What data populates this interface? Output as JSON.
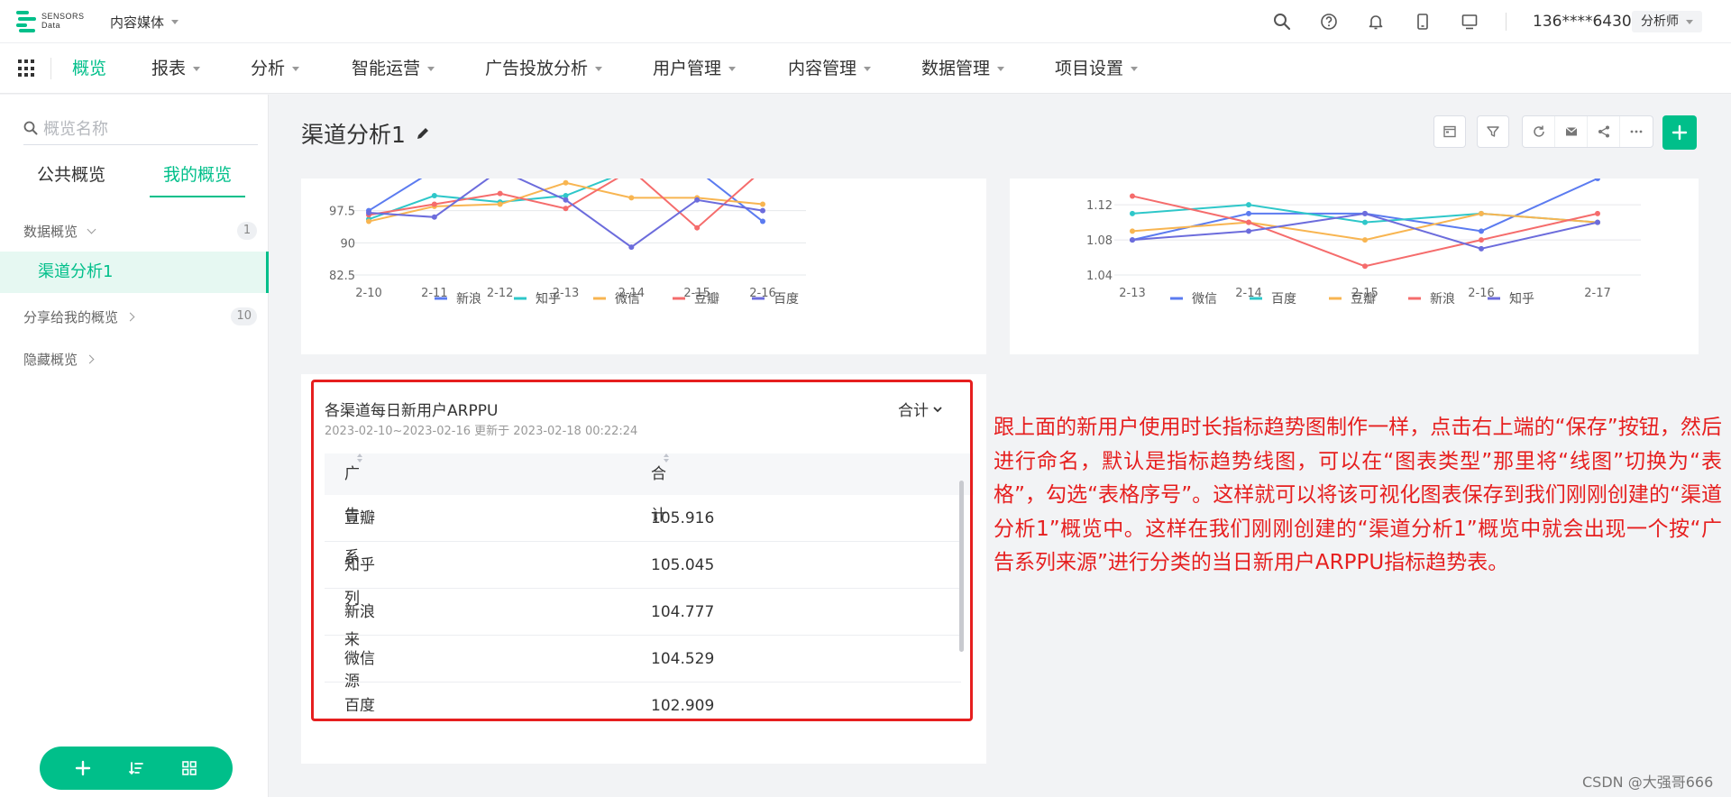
{
  "brand": {
    "logo_line1": "SENSORS",
    "logo_line2": "Data",
    "accent": "#00bf8a"
  },
  "project": {
    "name": "内容媒体"
  },
  "user": {
    "phone": "136****6430",
    "role": "分析师"
  },
  "nav": {
    "items": [
      {
        "label": "概览",
        "active": true,
        "dropdown": false
      },
      {
        "label": "报表",
        "dropdown": true
      },
      {
        "label": "分析",
        "dropdown": true
      },
      {
        "label": "智能运营",
        "dropdown": true
      },
      {
        "label": "广告投放分析",
        "dropdown": true
      },
      {
        "label": "用户管理",
        "dropdown": true
      },
      {
        "label": "内容管理",
        "dropdown": true
      },
      {
        "label": "数据管理",
        "dropdown": true
      },
      {
        "label": "项目设置",
        "dropdown": true
      }
    ]
  },
  "sidebar": {
    "search_placeholder": "概览名称",
    "tabs": [
      {
        "label": "公共概览"
      },
      {
        "label": "我的概览"
      }
    ],
    "groups": [
      {
        "label": "数据概览",
        "count": "1"
      },
      {
        "label": "分享给我的概览",
        "count": "10"
      },
      {
        "label": "隐藏概览"
      }
    ],
    "active_item": "渠道分析1"
  },
  "page": {
    "title": "渠道分析1"
  },
  "chart_data": [
    {
      "type": "line",
      "title": "",
      "categories": [
        "2-10",
        "2-11",
        "2-12",
        "2-13",
        "2-14",
        "2-15",
        "2-16"
      ],
      "y_ticks": [
        82.5,
        90,
        97.5
      ],
      "ylim": [
        82.5,
        105
      ],
      "clipped_top": true,
      "legend_position": "bottom",
      "series": [
        {
          "name": "新浪",
          "color": "#5b7bf0",
          "values": [
            97.5,
            107,
            107,
            107,
            107,
            107,
            95
          ]
        },
        {
          "name": "知乎",
          "color": "#2ec7c9",
          "values": [
            95.5,
            101,
            99.5,
            101,
            107,
            107,
            107
          ]
        },
        {
          "name": "微信",
          "color": "#f8b551",
          "values": [
            95,
            98.5,
            99,
            104,
            100.5,
            100.5,
            99
          ]
        },
        {
          "name": "豆瓣",
          "color": "#f56c6c",
          "values": [
            96.5,
            99,
            101.5,
            98,
            107,
            93.5,
            107
          ]
        },
        {
          "name": "百度",
          "color": "#6c6cdc",
          "values": [
            97,
            96,
            107,
            100,
            89,
            100,
            97.5
          ]
        }
      ]
    },
    {
      "type": "line",
      "title": "",
      "categories": [
        "2-13",
        "2-14",
        "2-15",
        "2-16",
        "2-17"
      ],
      "y_ticks": [
        1.04,
        1.08,
        1.12
      ],
      "ylim": [
        1.04,
        1.15
      ],
      "clipped_top": true,
      "legend_position": "bottom",
      "series": [
        {
          "name": "微信",
          "color": "#5b7bf0",
          "values": [
            1.08,
            1.11,
            1.11,
            1.09,
            1.15
          ]
        },
        {
          "name": "百度",
          "color": "#2ec7c9",
          "values": [
            1.11,
            1.12,
            1.1,
            1.11,
            1.1
          ]
        },
        {
          "name": "豆瓣",
          "color": "#f8b551",
          "values": [
            1.09,
            1.1,
            1.08,
            1.11,
            1.1
          ]
        },
        {
          "name": "新浪",
          "color": "#f56c6c",
          "values": [
            1.13,
            1.1,
            1.05,
            1.08,
            1.11
          ]
        },
        {
          "name": "知乎",
          "color": "#6c6cdc",
          "values": [
            1.08,
            1.09,
            1.11,
            1.07,
            1.1
          ]
        }
      ]
    }
  ],
  "table_card": {
    "title": "各渠道每日新用户ARPPU",
    "subtitle": "2023-02-10~2023-02-16 更新于 2023-02-18 00:22:24",
    "aggregate": "合计",
    "columns": [
      "广告系列来源",
      "合计"
    ],
    "rows": [
      [
        "豆瓣",
        "105.916"
      ],
      [
        "知乎",
        "105.045"
      ],
      [
        "新浪",
        "104.777"
      ],
      [
        "微信",
        "104.529"
      ],
      [
        "百度",
        "102.909"
      ]
    ]
  },
  "annotation": "跟上面的新用户使用时长指标趋势图制作一样，点击右上端的“保存”按钮，然后进行命名，默认是指标趋势线图，可以在“图表类型”那里将“线图”切换为“表格”，勾选“表格序号”。这样就可以将该可视化图表保存到我们刚刚创建的“渠道分析1”概览中。这样在我们刚刚创建的“渠道分析1”概览中就会出现一个按“广告系列来源”进行分类的当日新用户ARPPU指标趋势表。",
  "watermark": "CSDN @大强哥666"
}
